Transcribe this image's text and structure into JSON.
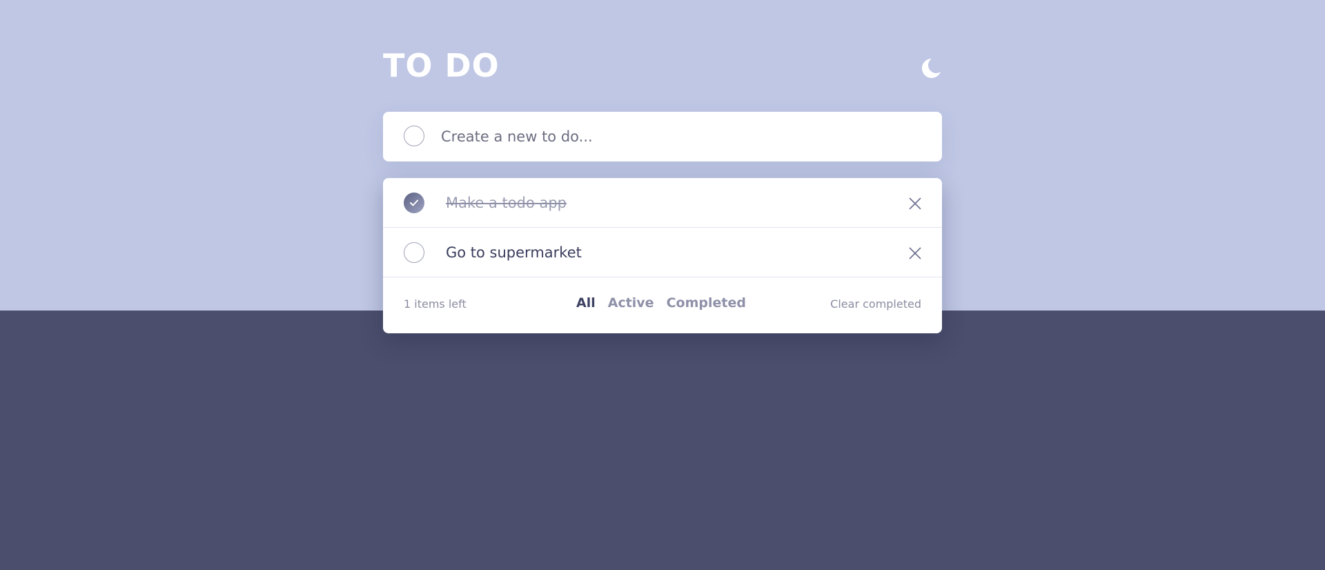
{
  "app": {
    "title": "TO DO",
    "theme_icon": "moon-icon"
  },
  "new_todo": {
    "placeholder": "Create a new to do...",
    "value": ""
  },
  "todos": [
    {
      "text": "Make a todo app",
      "completed": true
    },
    {
      "text": "Go to supermarket",
      "completed": false
    }
  ],
  "footer": {
    "items_left": "1 items left",
    "filters": [
      "All",
      "Active",
      "Completed"
    ],
    "active_filter": "All",
    "clear_label": "Clear completed"
  },
  "colors": {
    "background_top": "#bfc7e5",
    "background_bottom": "#4b4e6c",
    "text_primary": "#3a3d5c",
    "text_muted": "#8a8ca0",
    "check_gradient_start": "#5c6182",
    "check_gradient_end": "#9ea3c2"
  }
}
